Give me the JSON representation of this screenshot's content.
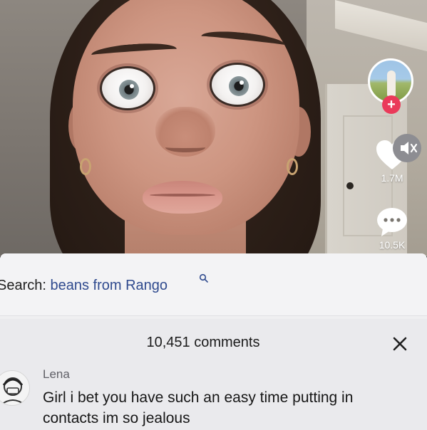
{
  "video": {
    "profile": {
      "follow_symbol": "+"
    },
    "likes": {
      "count": "1.7M",
      "icon": "heart-icon"
    },
    "comments": {
      "count": "10.5K",
      "icon": "comment-bubble-icon"
    }
  },
  "comments_panel": {
    "search": {
      "label": "Search:",
      "query": "beans from Rango",
      "icon": "search-icon"
    },
    "header": {
      "count_text": "10,451 comments",
      "close_icon": "close-icon"
    },
    "items": [
      {
        "author": "Lena",
        "text": "Girl i bet you have such an easy time putting in contacts im so jealous"
      }
    ],
    "mute_icon": "muted-speaker-icon"
  },
  "colors": {
    "follow_badge": "#ea3a5a",
    "search_query": "#2f4a8e",
    "panel_background": "#efeff1"
  }
}
